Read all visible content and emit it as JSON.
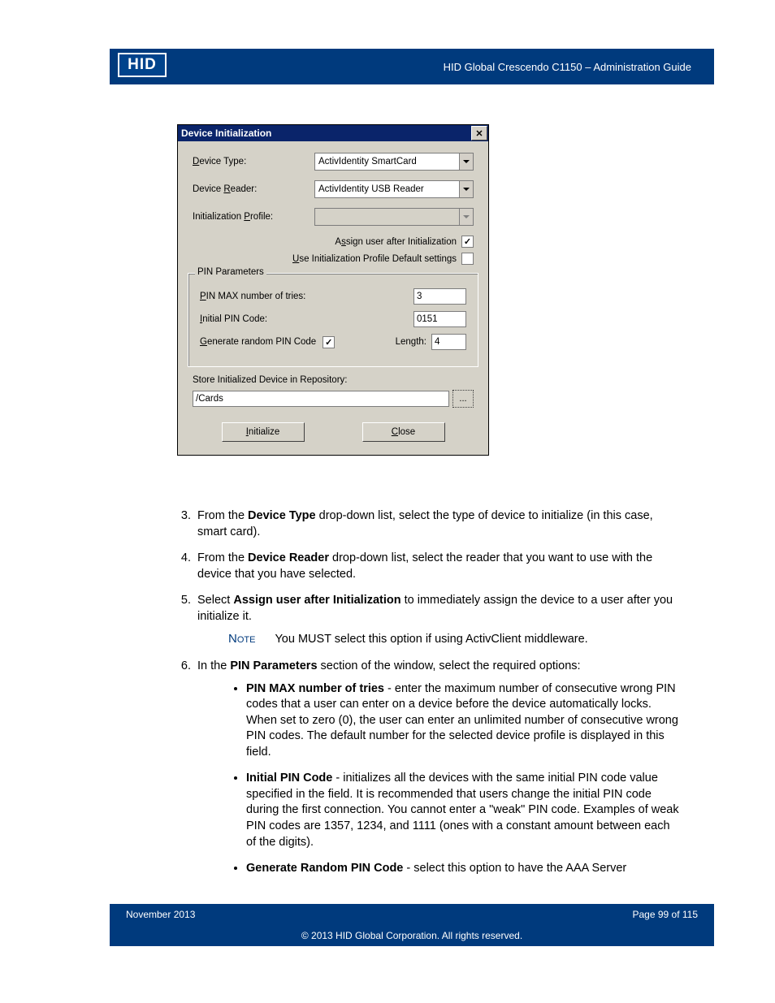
{
  "header": {
    "logo_text": "HID",
    "doc_title": "HID Global Crescendo C1150  – Administration Guide"
  },
  "dialog": {
    "title": "Device Initialization",
    "labels": {
      "device_type": "Device Type:",
      "device_reader": "Device Reader:",
      "init_profile": "Initialization Profile:",
      "assign_user": "Assign user after Initialization",
      "use_defaults": "Use Initialization Profile Default settings",
      "pin_params": "PIN Parameters",
      "pin_max": "PIN MAX number of tries:",
      "initial_pin": "Initial PIN Code:",
      "gen_random": "Generate random PIN Code",
      "length": "Length:",
      "store_label": "Store Initialized Device in Repository:",
      "initialize_btn": "Initialize",
      "close_btn": "Close"
    },
    "values": {
      "device_type": "ActivIdentity SmartCard",
      "device_reader": "ActivIdentity USB Reader",
      "init_profile": "",
      "pin_max": "3",
      "initial_pin": "0151",
      "length": "4",
      "store_path": "/Cards",
      "assign_user_checked": "✓",
      "gen_random_checked": "✓",
      "browse_dots": "..."
    }
  },
  "body": {
    "step3_a": "From the ",
    "step3_b": "Device Type",
    "step3_c": " drop-down list, select the type of device to initialize (in this case, smart card).",
    "step4_a": "From the ",
    "step4_b": "Device Reader",
    "step4_c": " drop-down list, select the reader that you want to use with the device that you have selected.",
    "step5_a": "Select ",
    "step5_b": "Assign user after Initialization",
    "step5_c": " to immediately assign the device to a user after you initialize it.",
    "note_label": "Note",
    "note_text": "You MUST select this option if using ActivClient middleware.",
    "step6_a": "In the ",
    "step6_b": "PIN Parameters",
    "step6_c": " section of the window, select the required options:",
    "b1_a": "PIN MAX number of tries",
    "b1_b": " - enter the maximum number of consecutive wrong PIN codes that a user can enter on a device before the device automatically locks. When set to zero (0), the user can enter an unlimited number of consecutive wrong PIN codes. The default number for the selected device profile is displayed in this field.",
    "b2_a": "Initial PIN Code",
    "b2_b": " - initializes all the devices with the same initial PIN code value specified in the field. It is recommended that users change the initial PIN code during the first connection. You cannot enter a \"weak\" PIN code. Examples of weak PIN codes are 1357, 1234, and 1111 (ones with a constant amount between each of the digits).",
    "b3_a": "Generate Random PIN Code",
    "b3_b": " - select this option to have the AAA Server"
  },
  "footer": {
    "date": "November 2013",
    "page": "Page 99 of 115",
    "copyright": "© 2013 HID Global Corporation. All rights reserved."
  }
}
